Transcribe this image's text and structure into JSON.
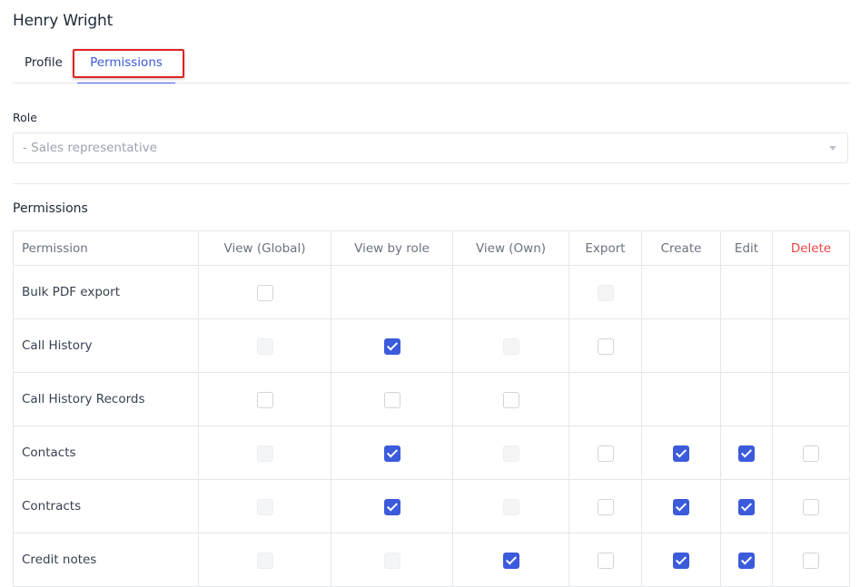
{
  "user": {
    "name": "Henry Wright"
  },
  "tabs": [
    {
      "label": "Profile",
      "active": false
    },
    {
      "label": "Permissions",
      "active": true
    }
  ],
  "role": {
    "label": "Role",
    "value": "- Sales representative"
  },
  "permissions": {
    "heading": "Permissions",
    "columns": [
      "Permission",
      "View (Global)",
      "View by role",
      "View (Own)",
      "Export",
      "Create",
      "Edit",
      "Delete"
    ],
    "rows": [
      {
        "name": "Bulk PDF export",
        "cells": [
          "empty",
          "none",
          "none",
          "disabled",
          "none",
          "none",
          "none"
        ]
      },
      {
        "name": "Call History",
        "cells": [
          "disabled",
          "checked",
          "disabled",
          "empty",
          "none",
          "none",
          "none"
        ]
      },
      {
        "name": "Call History Records",
        "cells": [
          "empty",
          "empty",
          "empty",
          "none",
          "none",
          "none",
          "none"
        ]
      },
      {
        "name": "Contacts",
        "cells": [
          "disabled",
          "checked",
          "disabled",
          "empty",
          "checked",
          "checked",
          "empty"
        ]
      },
      {
        "name": "Contracts",
        "cells": [
          "disabled",
          "checked",
          "disabled",
          "empty",
          "checked",
          "checked",
          "empty"
        ]
      },
      {
        "name": "Credit notes",
        "cells": [
          "disabled",
          "disabled",
          "checked",
          "empty",
          "checked",
          "checked",
          "empty"
        ]
      }
    ]
  },
  "colors": {
    "accent": "#3b5bdb",
    "delete": "#ef4444",
    "highlight": "#e02424"
  }
}
